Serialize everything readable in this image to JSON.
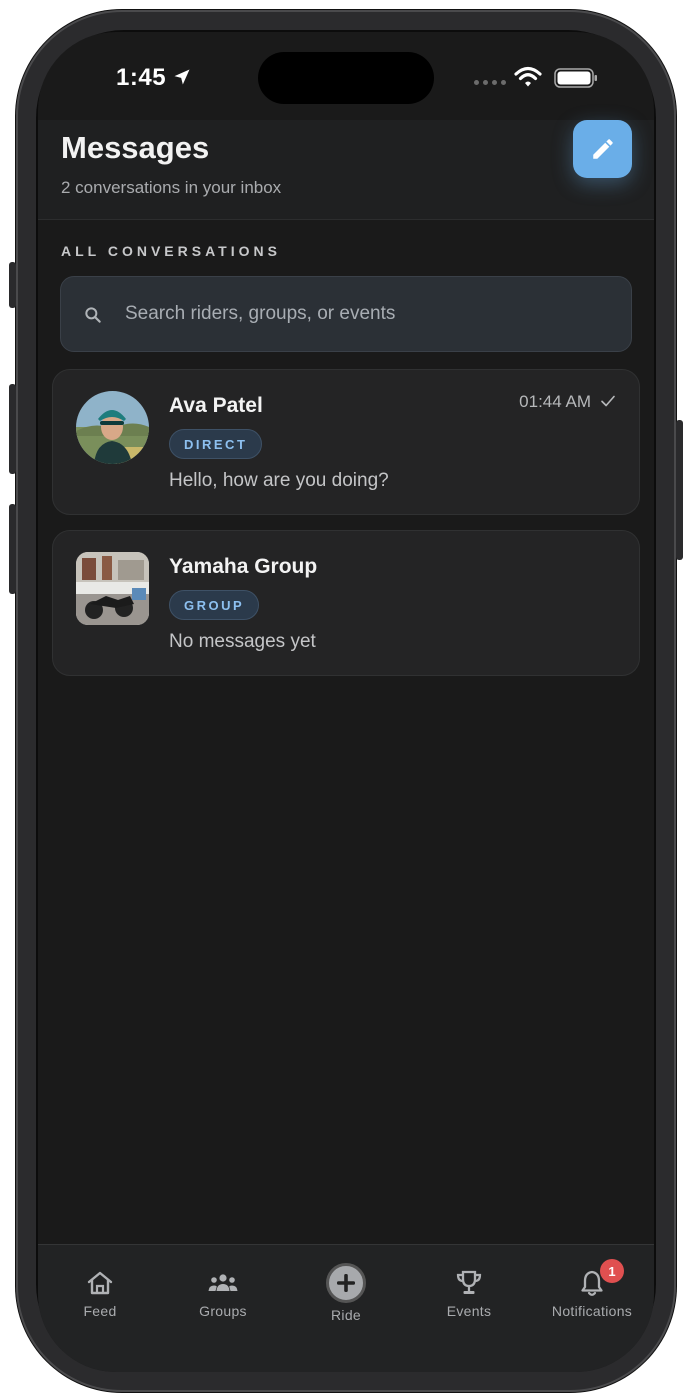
{
  "status_bar": {
    "time": "1:45"
  },
  "header": {
    "title": "Messages",
    "subtitle": "2 conversations in your inbox"
  },
  "section_label": "ALL CONVERSATIONS",
  "search": {
    "placeholder": "Search riders, groups, or events",
    "value": ""
  },
  "conversations": [
    {
      "name": "Ava Patel",
      "badge": "DIRECT",
      "preview": "Hello, how are you doing?",
      "time": "01:44 AM",
      "read_check": true
    },
    {
      "name": "Yamaha Group",
      "badge": "GROUP",
      "preview": "No messages yet"
    }
  ],
  "tabs": [
    {
      "label": "Feed",
      "icon": "home-icon"
    },
    {
      "label": "Groups",
      "icon": "groups-icon"
    },
    {
      "label": "Ride",
      "icon": "plus-circle-icon"
    },
    {
      "label": "Events",
      "icon": "trophy-icon"
    },
    {
      "label": "Notifications",
      "icon": "bell-icon",
      "badge": "1"
    }
  ],
  "colors": {
    "background": "#1a1a1a",
    "accent": "#6aaee8",
    "badge_text": "#8dc0f0",
    "notification": "#e05050"
  }
}
